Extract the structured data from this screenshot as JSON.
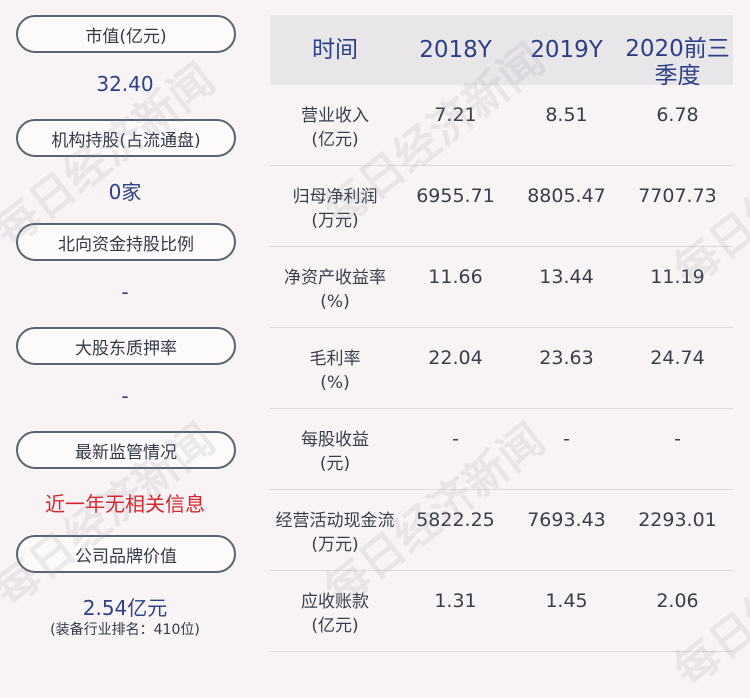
{
  "left": {
    "market_cap_label": "市值(亿元)",
    "market_cap_value": "32.40",
    "institution_label": "机构持股(占流通盘)",
    "institution_value": "0家",
    "northbound_label": "北向资金持股比例",
    "northbound_value": "-",
    "pledge_label": "大股东质押率",
    "pledge_value": "-",
    "supervision_label": "最新监管情况",
    "supervision_value": "近一年无相关信息",
    "brand_label": "公司品牌价值",
    "brand_value": "2.54亿元",
    "brand_note": "(装备行业排名：410位)"
  },
  "table": {
    "headers": [
      "时间",
      "2018Y",
      "2019Y",
      "2020前三季度"
    ],
    "rows": [
      {
        "label1": "营业收入",
        "label2": "(亿元)",
        "v": [
          "7.21",
          "8.51",
          "6.78"
        ]
      },
      {
        "label1": "归母净利润",
        "label2": "(万元)",
        "v": [
          "6955.71",
          "8805.47",
          "7707.73"
        ]
      },
      {
        "label1": "净资产收益率",
        "label2": "(%)",
        "v": [
          "11.66",
          "13.44",
          "11.19"
        ]
      },
      {
        "label1": "毛利率",
        "label2": "(%)",
        "v": [
          "22.04",
          "23.63",
          "24.74"
        ]
      },
      {
        "label1": "每股收益",
        "label2": "(元)",
        "v": [
          "-",
          "-",
          "-"
        ]
      },
      {
        "label1": "经营活动现金流",
        "label2": "(万元)",
        "v": [
          "5822.25",
          "7693.43",
          "2293.01"
        ]
      },
      {
        "label1": "应收账款",
        "label2": "(亿元)",
        "v": [
          "1.31",
          "1.45",
          "2.06"
        ]
      }
    ]
  },
  "watermark": "每日经济新闻"
}
